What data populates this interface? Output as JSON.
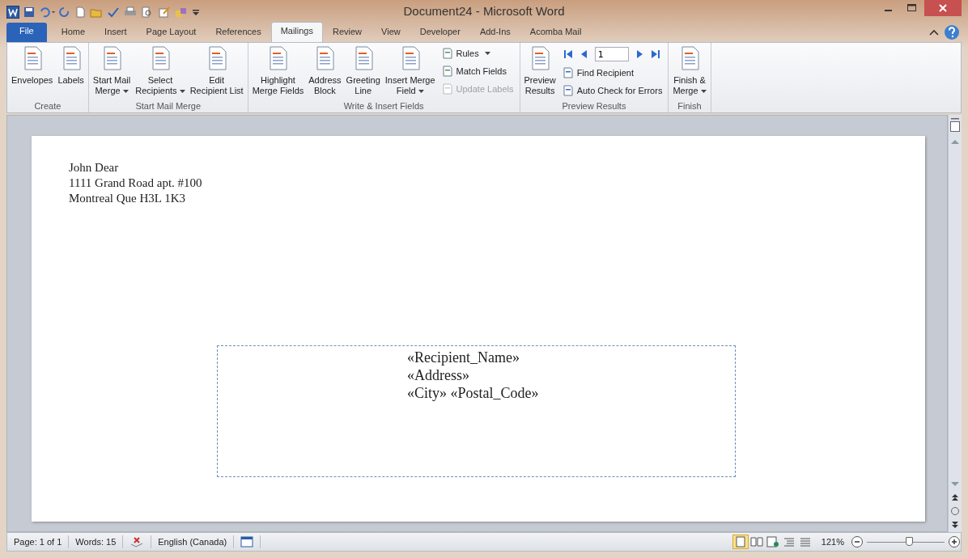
{
  "window": {
    "title": "Document24 - Microsoft Word"
  },
  "tabs": [
    {
      "label": "File",
      "kind": "file",
      "selected": false
    },
    {
      "label": "Home",
      "kind": "tab",
      "selected": false
    },
    {
      "label": "Insert",
      "kind": "tab",
      "selected": false
    },
    {
      "label": "Page Layout",
      "kind": "tab",
      "selected": false
    },
    {
      "label": "References",
      "kind": "tab",
      "selected": false
    },
    {
      "label": "Mailings",
      "kind": "tab",
      "selected": true
    },
    {
      "label": "Review",
      "kind": "tab",
      "selected": false
    },
    {
      "label": "View",
      "kind": "tab",
      "selected": false
    },
    {
      "label": "Developer",
      "kind": "tab",
      "selected": false
    },
    {
      "label": "Add-Ins",
      "kind": "tab",
      "selected": false
    },
    {
      "label": "Acomba Mail",
      "kind": "tab",
      "selected": false
    }
  ],
  "ribbon": [
    {
      "label": "Create",
      "items": [
        {
          "kind": "large",
          "lines": [
            "Envelopes"
          ],
          "dropdown": false,
          "disabled": false
        },
        {
          "kind": "large",
          "lines": [
            "Labels"
          ],
          "dropdown": false,
          "disabled": false
        }
      ]
    },
    {
      "label": "Start Mail Merge",
      "items": [
        {
          "kind": "large",
          "lines": [
            "Start Mail",
            "Merge"
          ],
          "dropdown": true,
          "disabled": false
        },
        {
          "kind": "large",
          "lines": [
            "Select",
            "Recipients"
          ],
          "dropdown": true,
          "disabled": false
        },
        {
          "kind": "large",
          "lines": [
            "Edit",
            "Recipient List"
          ],
          "dropdown": false,
          "disabled": false
        }
      ]
    },
    {
      "label": "Write & Insert Fields",
      "items": [
        {
          "kind": "large",
          "lines": [
            "Highlight",
            "Merge Fields"
          ],
          "dropdown": false,
          "disabled": false
        },
        {
          "kind": "large",
          "lines": [
            "Address",
            "Block"
          ],
          "dropdown": false,
          "disabled": false
        },
        {
          "kind": "large",
          "lines": [
            "Greeting",
            "Line"
          ],
          "dropdown": false,
          "disabled": false
        },
        {
          "kind": "large",
          "lines": [
            "Insert Merge",
            "Field"
          ],
          "dropdown": true,
          "disabled": false
        },
        {
          "kind": "stack",
          "smalls": [
            {
              "label": "Rules",
              "dropdown": true,
              "disabled": false
            },
            {
              "label": "Match Fields",
              "dropdown": false,
              "disabled": false
            },
            {
              "label": "Update Labels",
              "dropdown": false,
              "disabled": true
            }
          ]
        }
      ]
    },
    {
      "label": "Preview Results",
      "items": [
        {
          "kind": "large",
          "lines": [
            "Preview",
            "Results"
          ],
          "dropdown": false,
          "disabled": false
        },
        {
          "kind": "nav",
          "record": "1",
          "smalls": [
            {
              "label": "Find Recipient",
              "disabled": false
            },
            {
              "label": "Auto Check for Errors",
              "disabled": false
            }
          ]
        }
      ]
    },
    {
      "label": "Finish",
      "items": [
        {
          "kind": "large",
          "lines": [
            "Finish &",
            "Merge"
          ],
          "dropdown": true,
          "disabled": false
        }
      ]
    }
  ],
  "document": {
    "sender": [
      "John Dear",
      "1111 Grand Road apt. #100",
      "Montreal Que H3L 1K3"
    ],
    "merge_fields": [
      "«Recipient_Name»",
      "«Address»",
      "«City» «Postal_Code»"
    ]
  },
  "status_bar": {
    "page": "Page: 1 of 1",
    "words": "Words: 15",
    "language": "English (Canada)",
    "zoom": "121%",
    "zoom_slider": {
      "level": 0.55
    }
  }
}
